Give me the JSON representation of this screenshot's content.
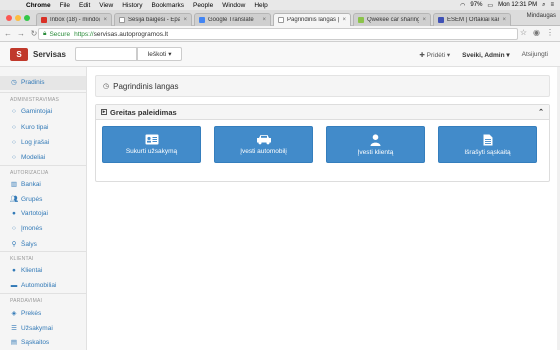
{
  "macos_menu": {
    "app": "Chrome",
    "items": [
      "File",
      "Edit",
      "View",
      "History",
      "Bookmarks",
      "People",
      "Window",
      "Help"
    ],
    "battery": "97%",
    "clock": "Mon 12:31 PM"
  },
  "browser": {
    "tabs": [
      {
        "label": "Inbox (18) - mindo@...",
        "color": "#d93025",
        "active": false
      },
      {
        "label": "Sesija baigėsi - Epay",
        "color": "#666",
        "active": false
      },
      {
        "label": "Google Translate",
        "color": "#4285f4",
        "active": false
      },
      {
        "label": "Pagrindinis langas | A",
        "color": "#888",
        "active": true
      },
      {
        "label": "Qwekee car sharing a",
        "color": "#8bc34a",
        "active": false
      },
      {
        "label": "ESEM | Ortakiai kartu",
        "color": "#3f51b5",
        "active": false
      }
    ],
    "profile": "Mindaugas",
    "secure_label": "Secure",
    "url_scheme": "https://",
    "url_host": "servisas.autoprogramos.lt"
  },
  "appnav": {
    "brand": "Servisas",
    "logo_text": "S",
    "search_placeholder": "",
    "search_button": "Ieškoti",
    "add_label": "Pridėti",
    "user_label": "Sveiki, Admin",
    "logout_label": "Atsijungti"
  },
  "sidebar": {
    "home": "Pradinis",
    "sections": [
      {
        "title": "ADMINISTRAVIMAS",
        "items": [
          "Gamintojai",
          "Kuro tipai",
          "Log įrašai",
          "Modeliai"
        ]
      },
      {
        "title": "AUTORIZACIJA",
        "items": [
          "Bankai",
          "Grupės",
          "Vartotojai",
          "Įmonės",
          "Šalys"
        ]
      },
      {
        "title": "KLIENTAI",
        "items": [
          "Klientai",
          "Automobiliai"
        ]
      },
      {
        "title": "PARDAVIMAI",
        "items": [
          "Prekės",
          "Užsakymai",
          "Sąskaitos"
        ]
      }
    ]
  },
  "main": {
    "page_title": "Pagrindinis langas",
    "panel_title": "Greitas paleidimas",
    "quick_buttons": [
      {
        "label": "Sukurti užsakymą",
        "icon": "id-card-icon"
      },
      {
        "label": "Įvesti automobilį",
        "icon": "car-icon"
      },
      {
        "label": "Įvesti klientą",
        "icon": "user-icon"
      },
      {
        "label": "Išrašyti sąskaitą",
        "icon": "document-icon"
      }
    ]
  },
  "colors": {
    "primary": "#428bca",
    "link": "#337ab7",
    "brand": "#c0392b"
  }
}
